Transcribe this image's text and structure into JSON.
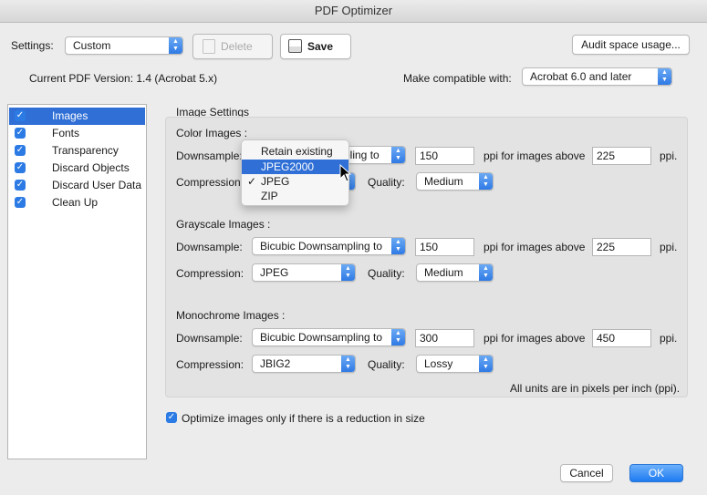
{
  "window": {
    "title": "PDF Optimizer"
  },
  "toolbar": {
    "settings_label": "Settings:",
    "settings_value": "Custom",
    "delete_label": "Delete",
    "save_label": "Save",
    "audit_label": "Audit space usage..."
  },
  "version": {
    "current_label": "Current PDF Version: 1.4 (Acrobat 5.x)",
    "compat_label": "Make compatible with:",
    "compat_value": "Acrobat 6.0 and later"
  },
  "sidebar": {
    "items": [
      {
        "label": "Images",
        "checked": true,
        "selected": true
      },
      {
        "label": "Fonts",
        "checked": true
      },
      {
        "label": "Transparency",
        "checked": true
      },
      {
        "label": "Discard Objects",
        "checked": true
      },
      {
        "label": "Discard User Data",
        "checked": true
      },
      {
        "label": "Clean Up",
        "checked": true
      }
    ]
  },
  "image_settings": {
    "title": "Image Settings",
    "labels": {
      "downsample": "Downsample:",
      "compression": "Compression:",
      "quality": "Quality:",
      "ppi_above": "ppi for images above",
      "ppi": "ppi."
    },
    "color": {
      "heading": "Color Images :",
      "downsample_visible": "pling to",
      "ppi_value": "150",
      "above_value": "225",
      "quality": "Medium"
    },
    "grayscale": {
      "heading": "Grayscale Images :",
      "downsample": "Bicubic Downsampling to",
      "ppi_value": "150",
      "above_value": "225",
      "compression": "JPEG",
      "quality": "Medium"
    },
    "monochrome": {
      "heading": "Monochrome Images :",
      "downsample": "Bicubic Downsampling to",
      "ppi_value": "300",
      "above_value": "450",
      "compression": "JBIG2",
      "quality": "Lossy"
    },
    "units_note": "All units are in pixels per inch (ppi)."
  },
  "compression_menu": {
    "options": [
      {
        "label": "Retain existing"
      },
      {
        "label": "JPEG2000",
        "highlighted": true
      },
      {
        "label": "JPEG",
        "checked": true
      },
      {
        "label": "ZIP"
      }
    ]
  },
  "optimize_checkbox": {
    "label": "Optimize images only if there is a reduction in size",
    "checked": true
  },
  "footer": {
    "cancel_label": "Cancel",
    "ok_label": "OK"
  },
  "colors": {
    "accent": "#2f6fd6",
    "window_bg": "#ececec",
    "group_bg": "#e3e3e3"
  }
}
